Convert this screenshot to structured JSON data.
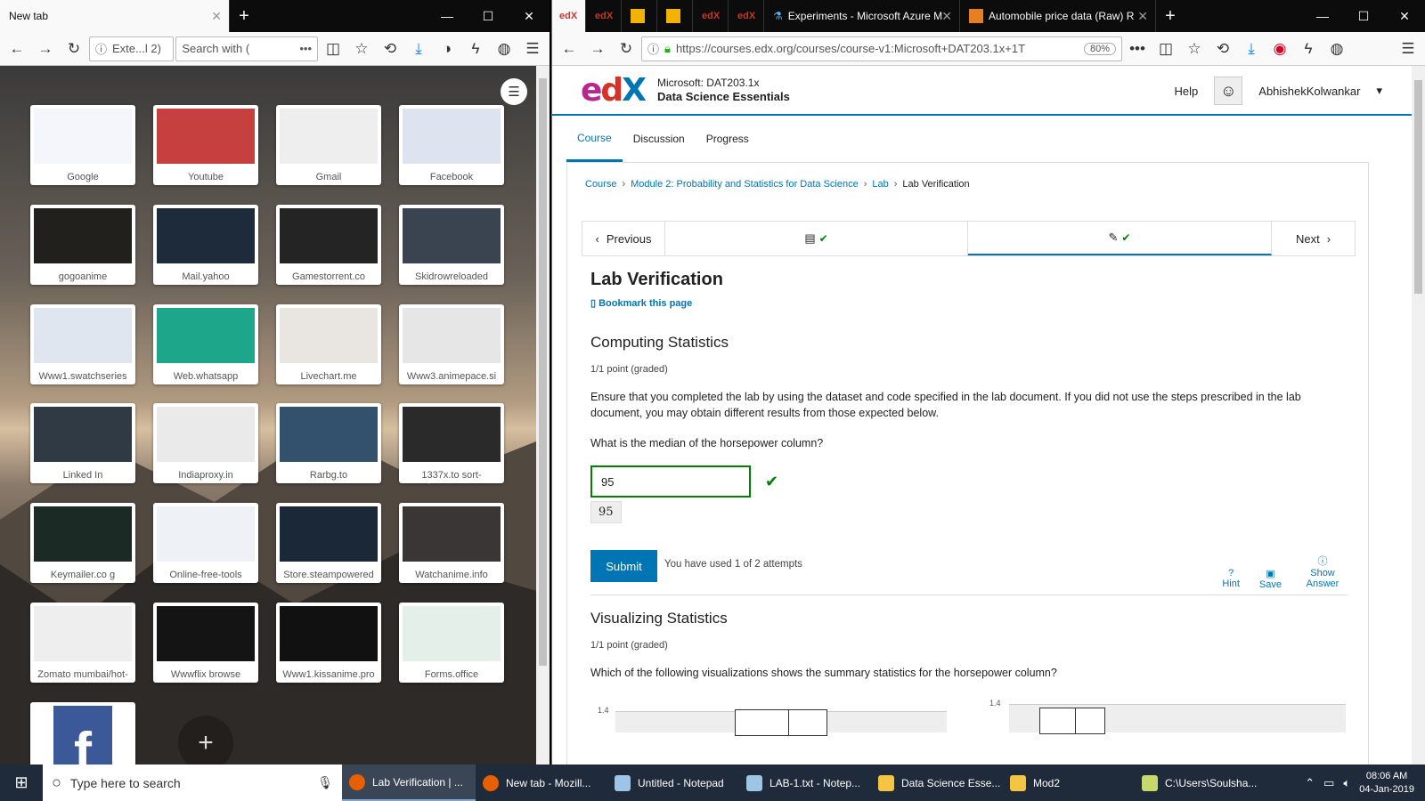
{
  "left": {
    "tab_title": "New tab",
    "url_text": "Exte...l 2)",
    "search_placeholder": "Search with (",
    "tiles": [
      {
        "label": "Google",
        "color": "#f4f6fb"
      },
      {
        "label": "Youtube",
        "color": "#c64040"
      },
      {
        "label": "Gmail",
        "color": "#eeeeee"
      },
      {
        "label": "Facebook",
        "color": "#dde4f0"
      },
      {
        "label": "gogoanime",
        "color": "#22201c"
      },
      {
        "label": "Mail.yahoo",
        "color": "#1e2b3a"
      },
      {
        "label": "Gamestorrent.co",
        "color": "#242424"
      },
      {
        "label": "Skidrowreloaded",
        "color": "#3a4450"
      },
      {
        "label": "Www1.swatchseries",
        "color": "#dfe6ef"
      },
      {
        "label": "Web.whatsapp",
        "color": "#1ea68a"
      },
      {
        "label": "Livechart.me",
        "color": "#e9e5e0"
      },
      {
        "label": "Www3.animepace.si",
        "color": "#e6e6e6"
      },
      {
        "label": "Linked In",
        "color": "#2f3a44"
      },
      {
        "label": "Indiaproxy.in",
        "color": "#eaeaea"
      },
      {
        "label": "Rarbg.to",
        "color": "#33506c"
      },
      {
        "label": "1337x.to sort-",
        "color": "#2a2a2a"
      },
      {
        "label": "Keymailer.co g",
        "color": "#1c2a26"
      },
      {
        "label": "Online-free-tools",
        "color": "#eef2f7"
      },
      {
        "label": "Store.steampowered",
        "color": "#1b2838"
      },
      {
        "label": "Watchanime.info",
        "color": "#3a3636"
      },
      {
        "label": "Zomato mumbai/hot-",
        "color": "#eeeeee"
      },
      {
        "label": "Wwwflix browse",
        "color": "#141414"
      },
      {
        "label": "Www1.kissanime.pro",
        "color": "#111111"
      },
      {
        "label": "Forms.office",
        "color": "#e4efe9"
      },
      {
        "label": "",
        "color": "#3b5998"
      }
    ]
  },
  "right": {
    "tabs": [
      "Experiments - Microsoft Azure M",
      "Automobile price data (Raw) R"
    ],
    "url": "https://courses.edx.org/courses/course-v1:Microsoft+DAT203.1x+1T",
    "zoom": "80%",
    "course_org": "Microsoft: DAT203.1x",
    "course_title": "Data Science Essentials",
    "help": "Help",
    "username": "AbhishekKolwankar",
    "course_tabs": [
      "Course",
      "Discussion",
      "Progress"
    ],
    "breadcrumb": [
      "Course",
      "Module 2: Probability and Statistics for Data Science",
      "Lab",
      "Lab Verification"
    ],
    "previous": "Previous",
    "next": "Next",
    "unit_title": "Lab Verification",
    "bookmark": "Bookmark this page",
    "problem1": {
      "title": "Computing Statistics",
      "grade": "1/1 point (graded)",
      "intro": "Ensure that you completed the lab by using the dataset and code specified in the lab document. If you did not use the steps prescribed in the lab document, you may obtain different results from those expected below.",
      "question": "What is the median of the horsepower column?",
      "answer": "95",
      "echo": "95",
      "submit": "Submit",
      "attempts": "You have used 1 of 2 attempts",
      "hint": "Hint",
      "save": "Save",
      "show_answer": "Show Answer"
    },
    "problem2": {
      "title": "Visualizing Statistics",
      "grade": "1/1 point (graded)",
      "question": "Which of the following visualizations shows the summary statistics for the horsepower column?",
      "tick": "1.4"
    }
  },
  "taskbar": {
    "search": "Type here to search",
    "items": [
      "Lab Verification | ...",
      "New tab - Mozill...",
      "Untitled - Notepad",
      "LAB-1.txt - Notep...",
      "Data Science Esse...",
      "Mod2",
      "C:\\Users\\Soulsha..."
    ],
    "time": "08:06 AM",
    "date": "04-Jan-2019"
  }
}
